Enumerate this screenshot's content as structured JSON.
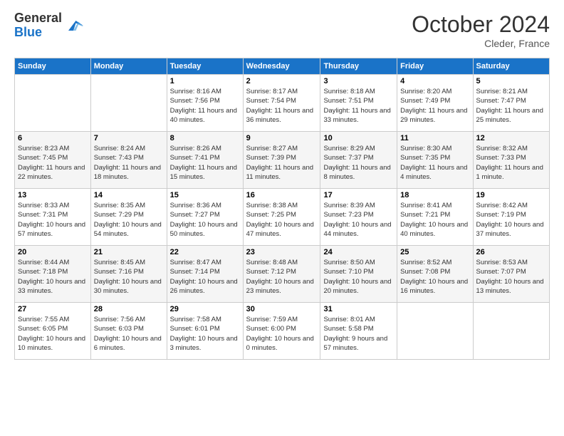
{
  "header": {
    "logo_general": "General",
    "logo_blue": "Blue",
    "month_title": "October 2024",
    "location": "Cleder, France"
  },
  "weekdays": [
    "Sunday",
    "Monday",
    "Tuesday",
    "Wednesday",
    "Thursday",
    "Friday",
    "Saturday"
  ],
  "weeks": [
    [
      {
        "day": "",
        "info": ""
      },
      {
        "day": "",
        "info": ""
      },
      {
        "day": "1",
        "info": "Sunrise: 8:16 AM\nSunset: 7:56 PM\nDaylight: 11 hours and 40 minutes."
      },
      {
        "day": "2",
        "info": "Sunrise: 8:17 AM\nSunset: 7:54 PM\nDaylight: 11 hours and 36 minutes."
      },
      {
        "day": "3",
        "info": "Sunrise: 8:18 AM\nSunset: 7:51 PM\nDaylight: 11 hours and 33 minutes."
      },
      {
        "day": "4",
        "info": "Sunrise: 8:20 AM\nSunset: 7:49 PM\nDaylight: 11 hours and 29 minutes."
      },
      {
        "day": "5",
        "info": "Sunrise: 8:21 AM\nSunset: 7:47 PM\nDaylight: 11 hours and 25 minutes."
      }
    ],
    [
      {
        "day": "6",
        "info": "Sunrise: 8:23 AM\nSunset: 7:45 PM\nDaylight: 11 hours and 22 minutes."
      },
      {
        "day": "7",
        "info": "Sunrise: 8:24 AM\nSunset: 7:43 PM\nDaylight: 11 hours and 18 minutes."
      },
      {
        "day": "8",
        "info": "Sunrise: 8:26 AM\nSunset: 7:41 PM\nDaylight: 11 hours and 15 minutes."
      },
      {
        "day": "9",
        "info": "Sunrise: 8:27 AM\nSunset: 7:39 PM\nDaylight: 11 hours and 11 minutes."
      },
      {
        "day": "10",
        "info": "Sunrise: 8:29 AM\nSunset: 7:37 PM\nDaylight: 11 hours and 8 minutes."
      },
      {
        "day": "11",
        "info": "Sunrise: 8:30 AM\nSunset: 7:35 PM\nDaylight: 11 hours and 4 minutes."
      },
      {
        "day": "12",
        "info": "Sunrise: 8:32 AM\nSunset: 7:33 PM\nDaylight: 11 hours and 1 minute."
      }
    ],
    [
      {
        "day": "13",
        "info": "Sunrise: 8:33 AM\nSunset: 7:31 PM\nDaylight: 10 hours and 57 minutes."
      },
      {
        "day": "14",
        "info": "Sunrise: 8:35 AM\nSunset: 7:29 PM\nDaylight: 10 hours and 54 minutes."
      },
      {
        "day": "15",
        "info": "Sunrise: 8:36 AM\nSunset: 7:27 PM\nDaylight: 10 hours and 50 minutes."
      },
      {
        "day": "16",
        "info": "Sunrise: 8:38 AM\nSunset: 7:25 PM\nDaylight: 10 hours and 47 minutes."
      },
      {
        "day": "17",
        "info": "Sunrise: 8:39 AM\nSunset: 7:23 PM\nDaylight: 10 hours and 44 minutes."
      },
      {
        "day": "18",
        "info": "Sunrise: 8:41 AM\nSunset: 7:21 PM\nDaylight: 10 hours and 40 minutes."
      },
      {
        "day": "19",
        "info": "Sunrise: 8:42 AM\nSunset: 7:19 PM\nDaylight: 10 hours and 37 minutes."
      }
    ],
    [
      {
        "day": "20",
        "info": "Sunrise: 8:44 AM\nSunset: 7:18 PM\nDaylight: 10 hours and 33 minutes."
      },
      {
        "day": "21",
        "info": "Sunrise: 8:45 AM\nSunset: 7:16 PM\nDaylight: 10 hours and 30 minutes."
      },
      {
        "day": "22",
        "info": "Sunrise: 8:47 AM\nSunset: 7:14 PM\nDaylight: 10 hours and 26 minutes."
      },
      {
        "day": "23",
        "info": "Sunrise: 8:48 AM\nSunset: 7:12 PM\nDaylight: 10 hours and 23 minutes."
      },
      {
        "day": "24",
        "info": "Sunrise: 8:50 AM\nSunset: 7:10 PM\nDaylight: 10 hours and 20 minutes."
      },
      {
        "day": "25",
        "info": "Sunrise: 8:52 AM\nSunset: 7:08 PM\nDaylight: 10 hours and 16 minutes."
      },
      {
        "day": "26",
        "info": "Sunrise: 8:53 AM\nSunset: 7:07 PM\nDaylight: 10 hours and 13 minutes."
      }
    ],
    [
      {
        "day": "27",
        "info": "Sunrise: 7:55 AM\nSunset: 6:05 PM\nDaylight: 10 hours and 10 minutes."
      },
      {
        "day": "28",
        "info": "Sunrise: 7:56 AM\nSunset: 6:03 PM\nDaylight: 10 hours and 6 minutes."
      },
      {
        "day": "29",
        "info": "Sunrise: 7:58 AM\nSunset: 6:01 PM\nDaylight: 10 hours and 3 minutes."
      },
      {
        "day": "30",
        "info": "Sunrise: 7:59 AM\nSunset: 6:00 PM\nDaylight: 10 hours and 0 minutes."
      },
      {
        "day": "31",
        "info": "Sunrise: 8:01 AM\nSunset: 5:58 PM\nDaylight: 9 hours and 57 minutes."
      },
      {
        "day": "",
        "info": ""
      },
      {
        "day": "",
        "info": ""
      }
    ]
  ]
}
